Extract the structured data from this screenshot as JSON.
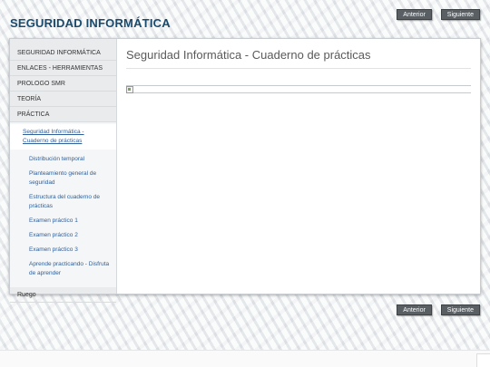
{
  "site": {
    "title": "SEGURIDAD INFORMÁTICA"
  },
  "nav": {
    "prev_label": "Anterior",
    "next_label": "Siguiente"
  },
  "sidebar": {
    "items": [
      {
        "label": "SEGURIDAD INFORMÁTICA"
      },
      {
        "label": "ENLACES - HERRAMIENTAS"
      },
      {
        "label": "PROLOGO SMR"
      },
      {
        "label": "TEORÍA"
      },
      {
        "label": "PRÁCTICA"
      }
    ],
    "subitems": [
      {
        "label": "Seguridad Informática - Cuaderno de prácticas"
      },
      {
        "label": "Distribución temporal"
      },
      {
        "label": "Planteamiento general de seguridad"
      },
      {
        "label": "Estructura del cuaderno de prácticas"
      },
      {
        "label": "Examen práctico 1"
      },
      {
        "label": "Examen práctico 2"
      },
      {
        "label": "Examen práctico 3"
      },
      {
        "label": "Aprende practicando - Disfruta de aprender"
      }
    ],
    "last_item": {
      "label": "Ruego"
    }
  },
  "main": {
    "title": "Seguridad Informática - Cuaderno de prácticas"
  },
  "colors": {
    "title": "#1a4a6b",
    "link": "#2f5f9a",
    "button": "#5a5f63"
  },
  "icons": {
    "broken_image": "broken-image-icon"
  }
}
